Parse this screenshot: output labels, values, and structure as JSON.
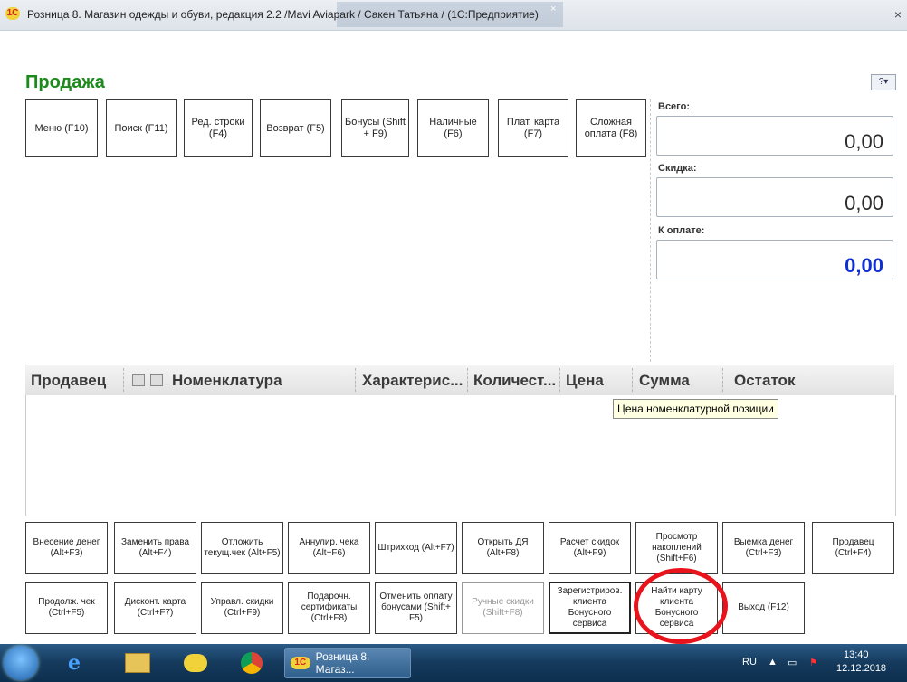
{
  "window": {
    "title": "Розница 8. Магазин одежды и обуви, редакция 2.2 /Mavi Aviapark / Сакен Татьяна / (1С:Предприятие)",
    "icon_text": "1С",
    "tab_close": "×",
    "close": "×"
  },
  "page": {
    "title": "Продажа",
    "help_label": "?▾"
  },
  "toolbar": [
    {
      "label": "Меню (F10)"
    },
    {
      "label": "Поиск (F11)"
    },
    {
      "label": "Ред. строки (F4)"
    },
    {
      "label": "Возврат (F5)"
    },
    {
      "label": "Бонусы (Shift + F9)"
    },
    {
      "label": "Наличные (F6)"
    },
    {
      "label": "Плат. карта (F7)"
    },
    {
      "label": "Сложная оплата (F8)"
    }
  ],
  "totals": {
    "total_label": "Всего:",
    "total_value": "0,00",
    "discount_label": "Скидка:",
    "discount_value": "0,00",
    "payable_label": "К оплате:",
    "payable_value": "0,00"
  },
  "grid": {
    "columns": [
      "Продавец",
      "Номенклатура",
      "Характерис...",
      "Количест...",
      "Цена",
      "Сумма",
      "Остаток"
    ],
    "tooltip": "Цена номенклатурной позиции"
  },
  "bottom_row1": [
    {
      "label": "Внесение денег (Alt+F3)"
    },
    {
      "label": "Заменить права (Alt+F4)"
    },
    {
      "label": "Отложить текущ.чек (Alt+F5)"
    },
    {
      "label": "Аннулир. чека (Alt+F6)"
    },
    {
      "label": "Штрихкод (Alt+F7)"
    },
    {
      "label": "Открыть ДЯ (Alt+F8)"
    },
    {
      "label": "Расчет скидок (Alt+F9)"
    },
    {
      "label": "Просмотр накоплений (Shift+F6)"
    },
    {
      "label": "Выемка денег (Ctrl+F3)"
    },
    {
      "label": "Продавец (Ctrl+F4)"
    }
  ],
  "bottom_row2": [
    {
      "label": "Продолж. чек (Ctrl+F5)"
    },
    {
      "label": "Дисконт. карта (Ctrl+F7)"
    },
    {
      "label": "Управл. скидки (Ctrl+F9)"
    },
    {
      "label": "Подарочн. сертификаты (Ctrl+F8)"
    },
    {
      "label": "Отменить оплату бонусами (Shift+ F5)"
    },
    {
      "label": "Ручные скидки (Shift+F8)"
    },
    {
      "label": "Зарегистриров. клиента Бонусного сервиса"
    },
    {
      "label": "Найти карту клиента Бонусного сервиса"
    },
    {
      "label": "Выход (F12)"
    }
  ],
  "taskbar": {
    "app_label": "Розница 8. Магаз...",
    "app_logo": "1С",
    "lang": "RU",
    "time": "13:40",
    "date": "12.12.2018"
  },
  "colors": {
    "title_green": "#1c8a1c",
    "payable_blue": "#0e2ed6",
    "highlight_red": "#e8131b"
  }
}
